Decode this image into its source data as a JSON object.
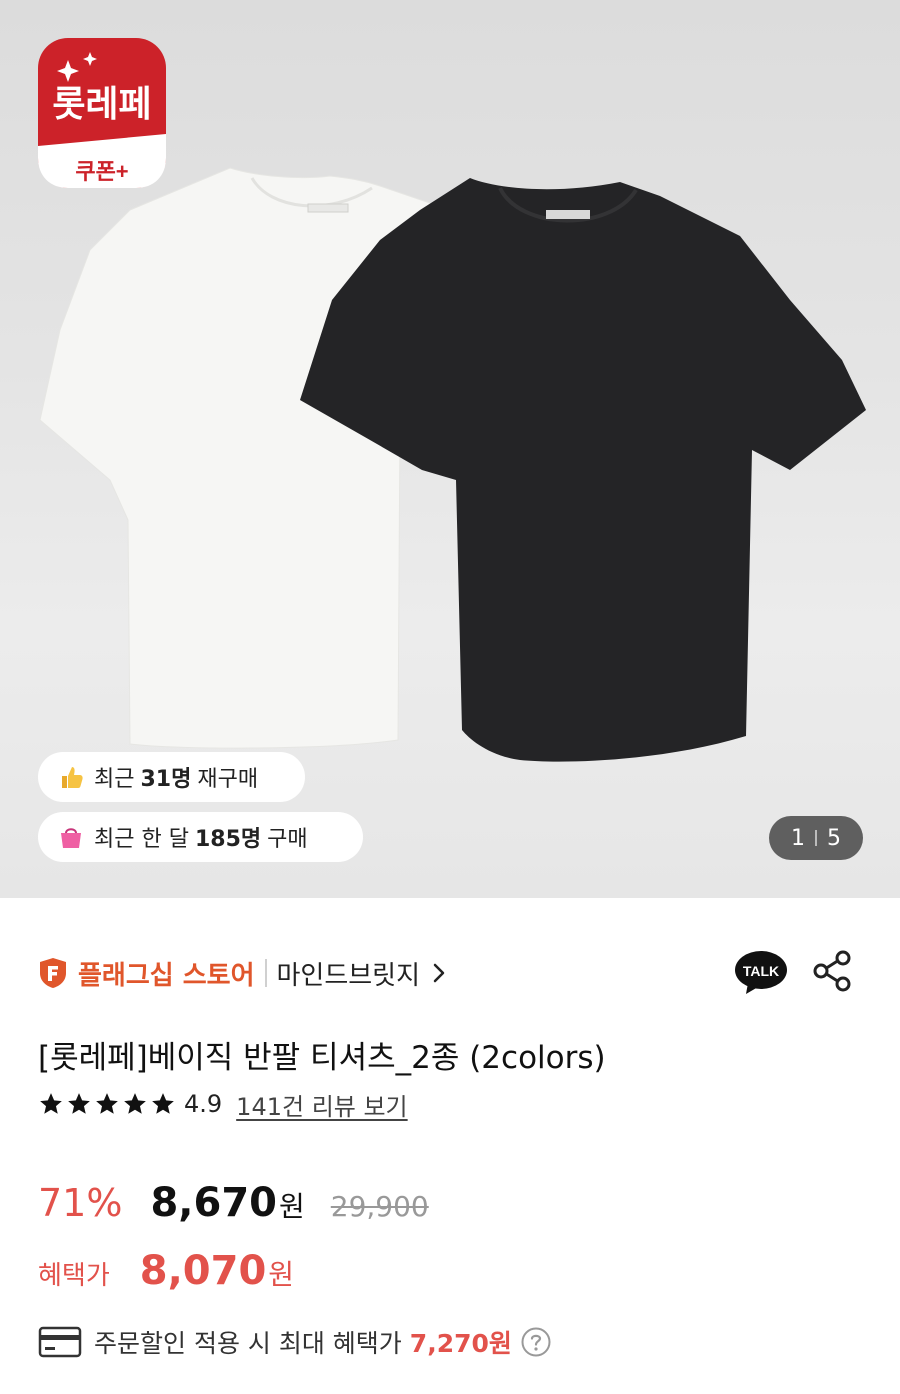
{
  "hero": {
    "badge": {
      "brand_text": "롯레페",
      "coupon_text": "쿠폰+"
    },
    "pills": [
      {
        "prefix": "최근",
        "highlight": "31명",
        "suffix": "재구매"
      },
      {
        "prefix": "최근 한 달",
        "highlight": "185명",
        "suffix": "구매"
      }
    ],
    "pager": {
      "current": "1",
      "total": "5"
    }
  },
  "store": {
    "flagship_label": "플래그십 스토어",
    "brand_name": "마인드브릿지"
  },
  "talk_label": "TALK",
  "product": {
    "title": "[롯레페]베이직 반팔 티셔츠_2종 (2colors)",
    "rating": "4.9",
    "stars": 5,
    "review_link": "141건 리뷰 보기"
  },
  "price": {
    "discount": "71%",
    "sale_price": "8,670",
    "currency": "원",
    "original_price": "29,900",
    "benefit_label": "혜택가",
    "benefit_price": "8,070",
    "benefit_currency": "원"
  },
  "coupon": {
    "text": "주문할인 적용 시 최대 혜택가",
    "price": "7,270원"
  },
  "colors": {
    "accent": "#e2524b",
    "flag": "#e0562b",
    "badge_red": "#cc2229"
  }
}
